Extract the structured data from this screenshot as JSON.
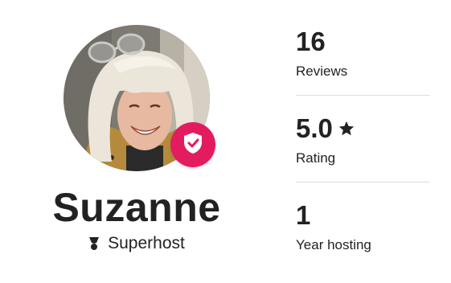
{
  "profile": {
    "name": "Suzanne",
    "role_label": "Superhost",
    "avatar_icon": "host-photo",
    "badge_icon": "verified-shield-check-icon",
    "badge_color": "#e31c5f",
    "role_icon": "superhost-icon"
  },
  "stats": [
    {
      "value": "16",
      "label": "Reviews"
    },
    {
      "value": "5.0",
      "label": "Rating",
      "icon": "star-icon"
    },
    {
      "value": "1",
      "label": "Year hosting"
    }
  ],
  "colors": {
    "text": "#222222",
    "divider": "#dddddd",
    "accent": "#e31c5f"
  }
}
